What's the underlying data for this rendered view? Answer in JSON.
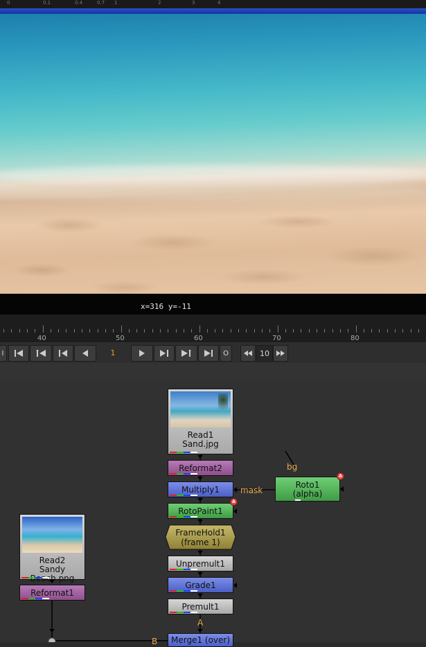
{
  "top_ruler": {
    "labels": [
      "0",
      "0.1",
      "0.4",
      "0.7",
      "1",
      "2",
      "3",
      "4"
    ]
  },
  "viewer": {
    "coordinates": "x=316 y=-11"
  },
  "timeline": {
    "frame_labels": [
      "40",
      "50",
      "60",
      "70",
      "80"
    ]
  },
  "transport": {
    "current_frame": "1",
    "increment": "10",
    "in_label": "I",
    "out_label": "O",
    "accent_color": "#e8a020"
  },
  "nodes": {
    "read1": {
      "name": "Read1",
      "file": "Sand.jpg"
    },
    "reformat2": {
      "name": "Reformat2"
    },
    "multiply1": {
      "name": "Multiply1"
    },
    "roto1": {
      "name": "Roto1",
      "sub": "(alpha)"
    },
    "rotopaint1": {
      "name": "RotoPaint1"
    },
    "framehold1": {
      "name": "FrameHold1",
      "sub": "(frame 1)"
    },
    "unpremult1": {
      "name": "Unpremult1"
    },
    "grade1": {
      "name": "Grade1"
    },
    "premult1": {
      "name": "Premult1"
    },
    "read2": {
      "name": "Read2",
      "file": "Sandy Beach.png"
    },
    "reformat1": {
      "name": "Reformat1"
    },
    "merge1": {
      "name": "Merge1 (over)"
    }
  },
  "pipes": {
    "mask": "mask",
    "bg": "bg",
    "a": "A",
    "b": "B"
  },
  "badges": {
    "roto1": "A",
    "rotopaint1": "A"
  }
}
